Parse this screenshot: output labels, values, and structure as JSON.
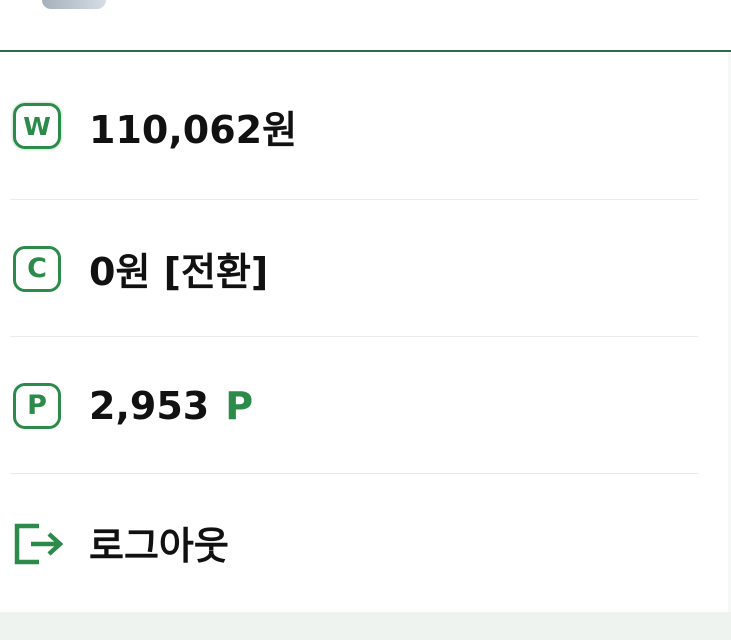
{
  "menu": {
    "won_balance": {
      "icon": "won-currency-badge-icon",
      "badge_letter": "W",
      "amount": "110,062원"
    },
    "cash_balance": {
      "icon": "cash-currency-badge-icon",
      "badge_letter": "C",
      "amount": "0원",
      "action": "[전환]"
    },
    "points": {
      "icon": "points-badge-icon",
      "badge_letter": "P",
      "amount": "2,953",
      "unit": "P"
    },
    "logout": {
      "icon": "logout-icon",
      "label": "로그아웃"
    }
  },
  "colors": {
    "accent": "#2c8a4a",
    "divider": "#e8ebea",
    "header_border": "#2f6b4a",
    "footer_bg": "#eef3f0"
  }
}
